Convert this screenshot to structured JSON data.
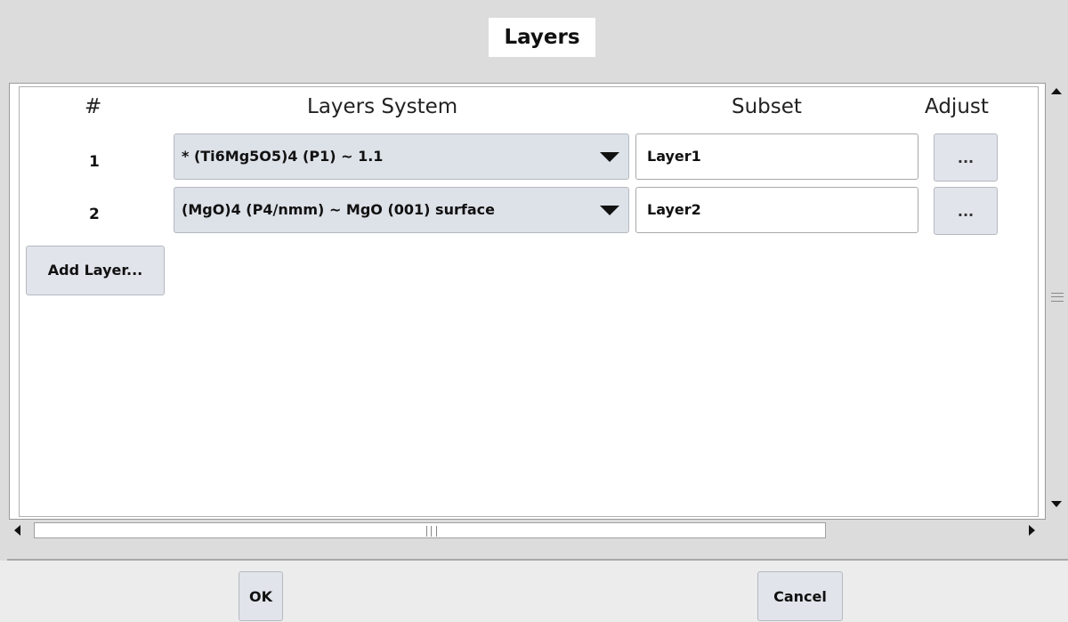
{
  "dialog": {
    "title": "Layers"
  },
  "columns": {
    "num": "#",
    "system": "Layers System",
    "subset": "Subset",
    "adjust": "Adjust"
  },
  "layers": [
    {
      "num": "1",
      "system": "* (Ti6Mg5O5)4  (P1) ~ 1.1",
      "subset": "Layer1",
      "adjust": "..."
    },
    {
      "num": "2",
      "system": "(MgO)4  (P4/nmm) ~ MgO (001)  surface",
      "subset": "Layer2",
      "adjust": "..."
    }
  ],
  "buttons": {
    "add_layer": "Add Layer...",
    "ok": "OK",
    "cancel": "Cancel"
  },
  "icons": {
    "combo_arrow": "chevron-down-icon",
    "scroll_up": "arrow-up-icon",
    "scroll_down": "arrow-down-icon",
    "scroll_left": "arrow-left-icon",
    "scroll_right": "arrow-right-icon"
  }
}
